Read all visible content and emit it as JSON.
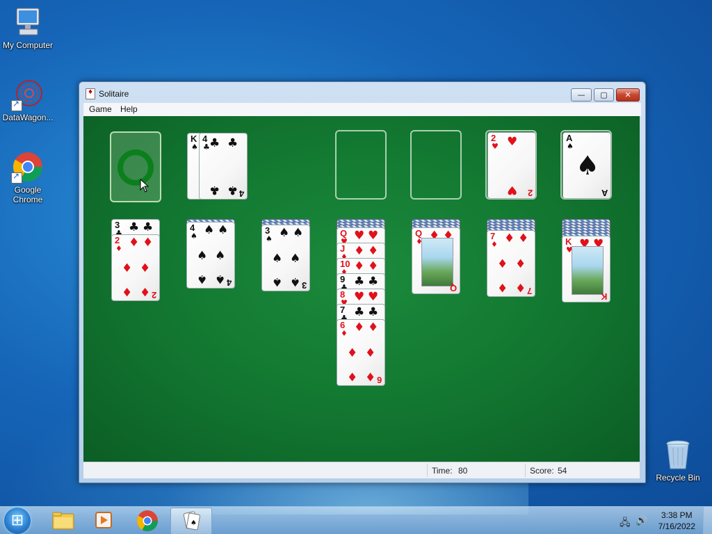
{
  "desktop": {
    "icons": [
      {
        "label": "My Computer"
      },
      {
        "label": "DataWagon..."
      },
      {
        "label": "Google Chrome"
      },
      {
        "label": "Recycle Bin"
      }
    ]
  },
  "window": {
    "title": "Solitaire",
    "minimize_glyph": "—",
    "maximize_glyph": "▢",
    "close_glyph": "✕"
  },
  "menu": {
    "game": "Game",
    "help": "Help"
  },
  "status": {
    "time_label": "Time:",
    "time_value": "80",
    "score_label": "Score:",
    "score_value": "54"
  },
  "game": {
    "stock": "empty-recycle",
    "waste": [
      {
        "rank": "K",
        "suit": "♠"
      },
      {
        "rank": "4",
        "suit": "♣"
      }
    ],
    "foundations": [
      {
        "rank": "",
        "suit": ""
      },
      {
        "rank": "",
        "suit": ""
      },
      {
        "rank": "2",
        "suit": "♥"
      },
      {
        "rank": "A",
        "suit": "♠"
      }
    ],
    "tableau": [
      {
        "hidden": 0,
        "cards": [
          {
            "rank": "3",
            "suit": "♣"
          },
          {
            "rank": "2",
            "suit": "♦"
          }
        ]
      },
      {
        "hidden": 1,
        "cards": [
          {
            "rank": "4",
            "suit": "♠"
          }
        ]
      },
      {
        "hidden": 2,
        "cards": [
          {
            "rank": "3",
            "suit": "♠"
          }
        ]
      },
      {
        "hidden": 3,
        "cards": [
          {
            "rank": "Q",
            "suit": "♥"
          },
          {
            "rank": "J",
            "suit": "♦"
          },
          {
            "rank": "10",
            "suit": "♦"
          },
          {
            "rank": "9",
            "suit": "♣"
          },
          {
            "rank": "8",
            "suit": "♥"
          },
          {
            "rank": "7",
            "suit": "♣"
          },
          {
            "rank": "6",
            "suit": "♦"
          }
        ]
      },
      {
        "hidden": 3,
        "cards": [
          {
            "rank": "Q",
            "suit": "♦"
          }
        ]
      },
      {
        "hidden": 4,
        "cards": [
          {
            "rank": "7",
            "suit": "♦"
          }
        ]
      },
      {
        "hidden": 6,
        "cards": [
          {
            "rank": "K",
            "suit": "♥"
          }
        ]
      }
    ]
  },
  "taskbar": {
    "clock_time": "3:38 PM",
    "clock_date": "7/16/2022"
  }
}
